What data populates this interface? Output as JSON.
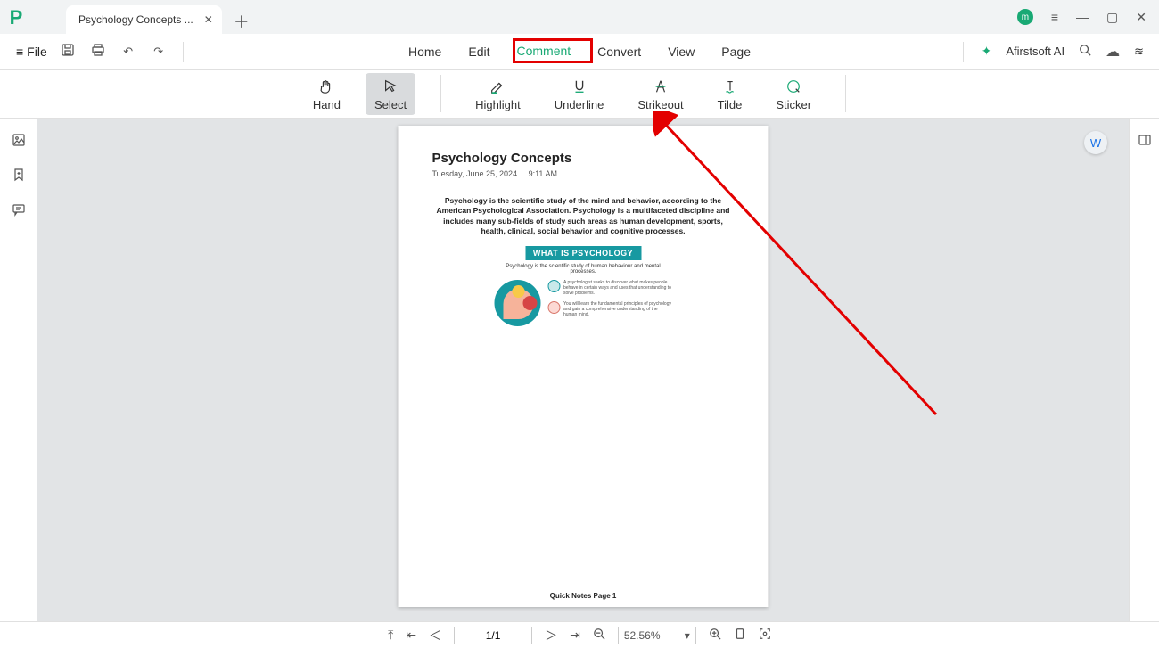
{
  "titlebar": {
    "tab_title": "Psychology Concepts ...",
    "user_initial": "m"
  },
  "toolbar": {
    "file_label": "File",
    "menu_items": [
      "Home",
      "Edit",
      "Comment",
      "Convert",
      "View",
      "Page"
    ],
    "active_menu_index": 2,
    "ai_label": "Afirstsoft AI"
  },
  "ribbon": {
    "items": [
      {
        "label": "Hand",
        "icon": "✋"
      },
      {
        "label": "Select",
        "icon": "⬉"
      },
      {
        "label": "Highlight",
        "icon": "✎"
      },
      {
        "label": "Underline",
        "icon": "U"
      },
      {
        "label": "Strikeout",
        "icon": "A"
      },
      {
        "label": "Tilde",
        "icon": "T"
      },
      {
        "label": "Sticker",
        "icon": "◯"
      }
    ],
    "selected_index": 1
  },
  "document": {
    "title": "Psychology Concepts",
    "date": "Tuesday, June 25, 2024",
    "time": "9:11 AM",
    "body": "Psychology is the scientific study of the mind and behavior, according to the American Psychological Association. Psychology is a multifaceted discipline and includes many sub-fields of study such areas as human development, sports, health, clinical, social behavior and cognitive processes.",
    "banner": "WHAT IS PSYCHOLOGY",
    "banner_sub": "Psychology is the scientific study of human behaviour and mental processes.",
    "mini1": "A psychologist seeks to discover what makes people behave in certain ways and uses that understanding to solve problems.",
    "mini2": "You will learn the fundamental principles of psychology and gain a comprehensive understanding of the human mind.",
    "footer": "Quick Notes Page 1"
  },
  "bottom": {
    "page_indicator": "1/1",
    "zoom": "52.56%"
  },
  "float_badge": "W"
}
